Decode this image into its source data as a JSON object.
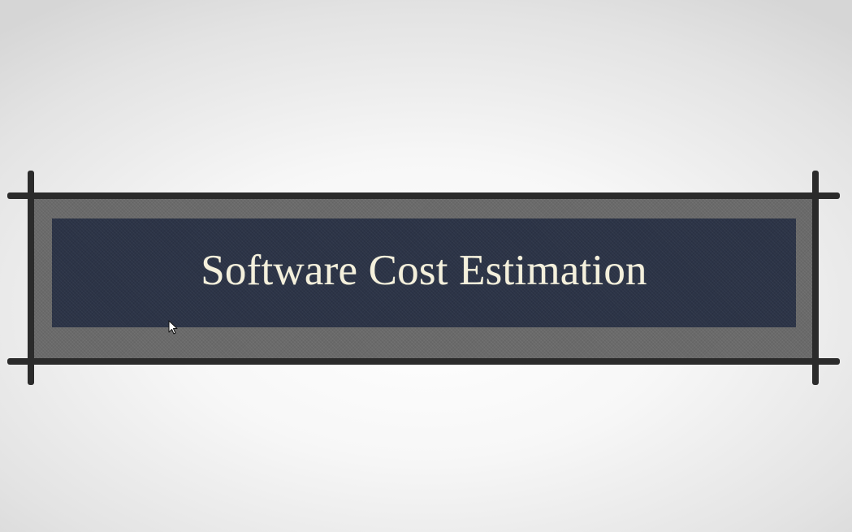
{
  "slide": {
    "title": "Software Cost Estimation"
  },
  "colors": {
    "background": "#f4f4f4",
    "frame_band": "#6a6a6a",
    "title_panel": "#2c3447",
    "frame_lines": "#2b2b2b",
    "title_text": "#f4f0dc"
  },
  "icons": {
    "cursor": "mouse-pointer-icon"
  }
}
